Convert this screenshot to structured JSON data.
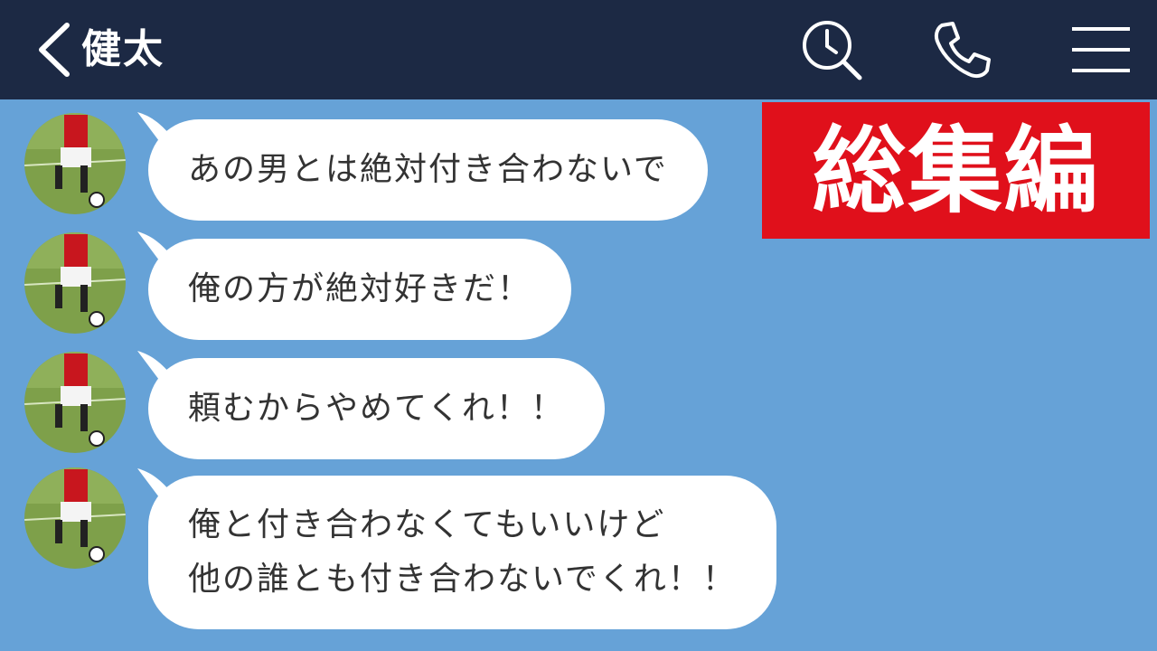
{
  "header": {
    "contact_name": "健太",
    "icons": {
      "back": "chevron-left-icon",
      "search": "clock-search-icon",
      "call": "phone-icon",
      "menu": "hamburger-menu-icon"
    },
    "background_color": "#1c2944"
  },
  "overlay": {
    "badge_text": "総集編",
    "badge_color": "#e0101b"
  },
  "chat": {
    "background_color": "#66a2d7",
    "messages": [
      {
        "lines": [
          "あの男とは絶対付き合わないで"
        ]
      },
      {
        "lines": [
          "俺の方が絶対好きだ！"
        ]
      },
      {
        "lines": [
          "頼むからやめてくれ！！"
        ]
      },
      {
        "lines": [
          "俺と付き合わなくてもいいけど",
          "他の誰とも付き合わないでくれ！！"
        ]
      }
    ]
  }
}
